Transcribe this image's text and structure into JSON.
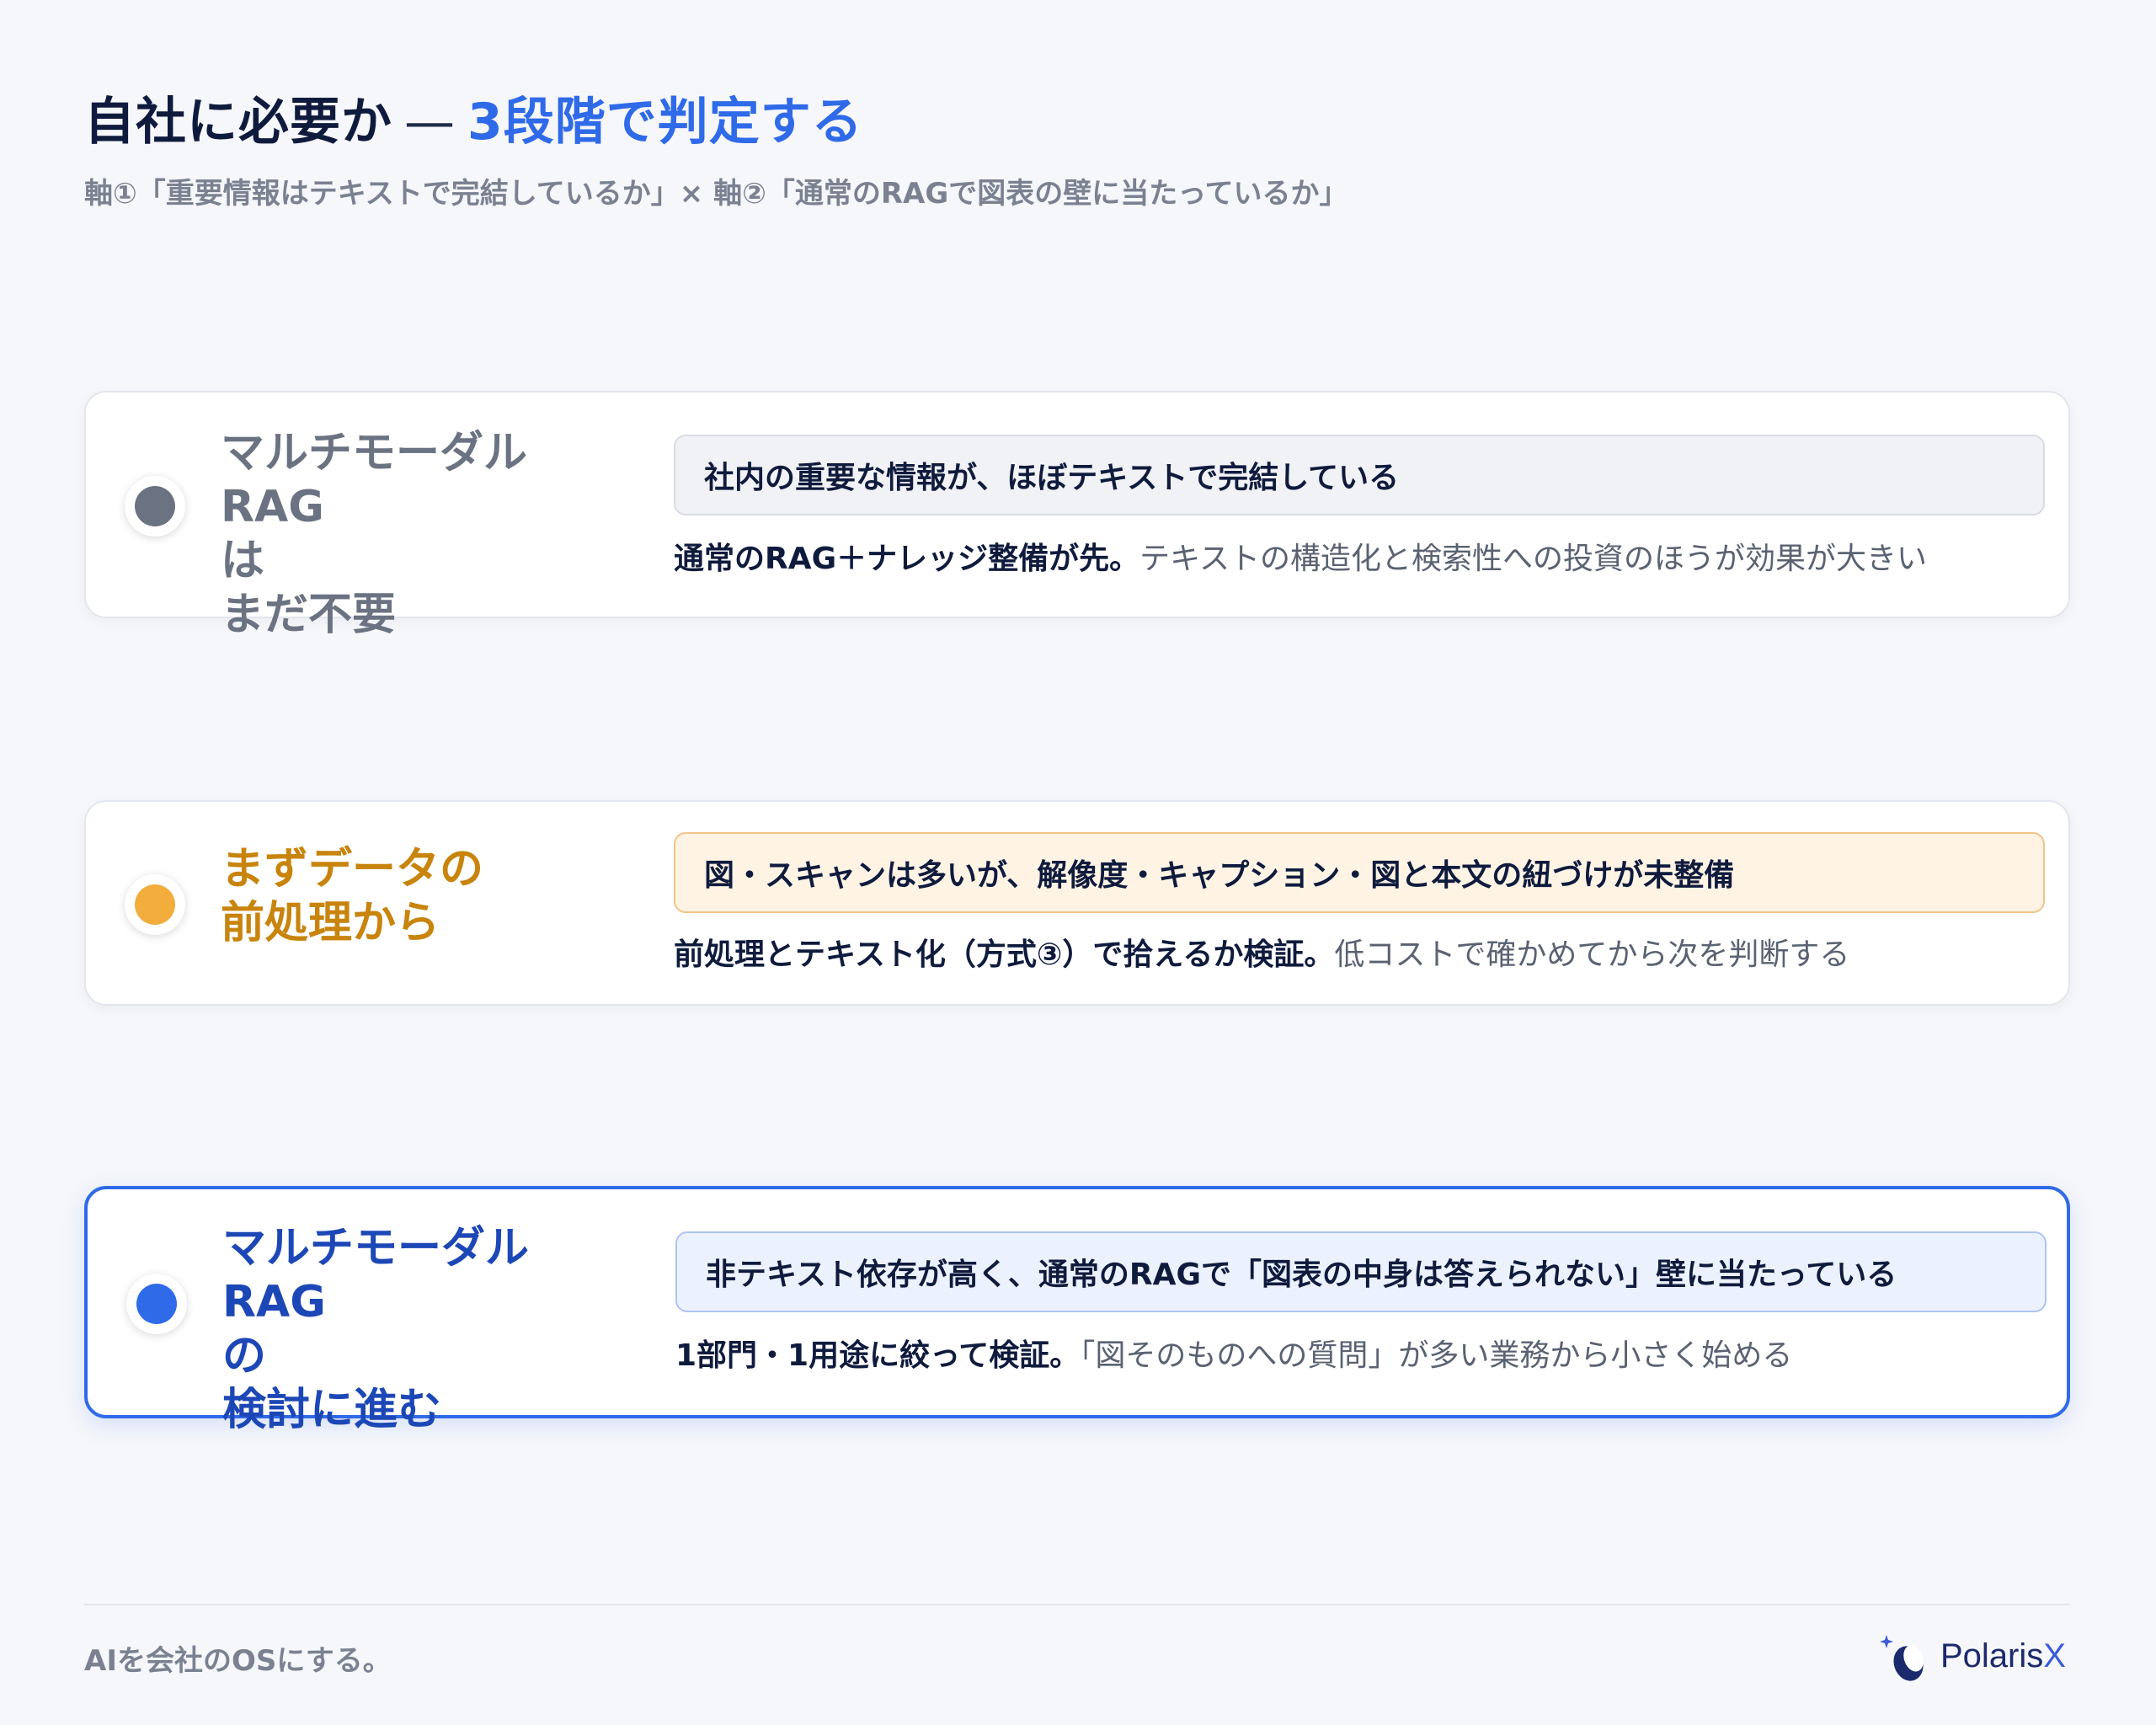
{
  "header": {
    "title_main": "自社に必要か",
    "title_dash": "—",
    "title_accent": "3段階で判定する",
    "subtitle": "軸①「重要情報はテキストで完結しているか」× 軸②「通常のRAGで図表の壁に当たっているか」"
  },
  "cards": [
    {
      "verdict": "マルチモーダルRAG\nは\nまだ不要",
      "condition": "社内の重要な情報が、ほぼテキストで完結している",
      "action_strong": "通常のRAG＋ナレッジ整備が先。",
      "action_rest": "テキストの構造化と検索性への投資のほうが効果が大きい",
      "color": "#6b7282"
    },
    {
      "verdict": "まずデータの\n前処理から",
      "condition": "図・スキャンは多いが、解像度・キャプション・図と本文の紐づけが未整備",
      "action_strong": "前処理とテキスト化（方式③）で拾えるか検証。",
      "action_rest": "低コストで確かめてから次を判断する",
      "color": "#f2ad3d"
    },
    {
      "verdict": "マルチモーダルRAG\nの\n検討に進む",
      "condition": "非テキスト依存が高く、通常のRAGで「図表の中身は答えられない」壁に当たっている",
      "action_strong": "1部門・1用途に絞って検証。",
      "action_rest": "「図そのものへの質問」が多い業務から小さく始める",
      "color": "#2f6ae8"
    }
  ],
  "footer": {
    "tagline": "AIを会社のOSにする。",
    "logo_main": "Polaris",
    "logo_x": "X",
    "logo_icon": "polarisx-logo-icon"
  }
}
